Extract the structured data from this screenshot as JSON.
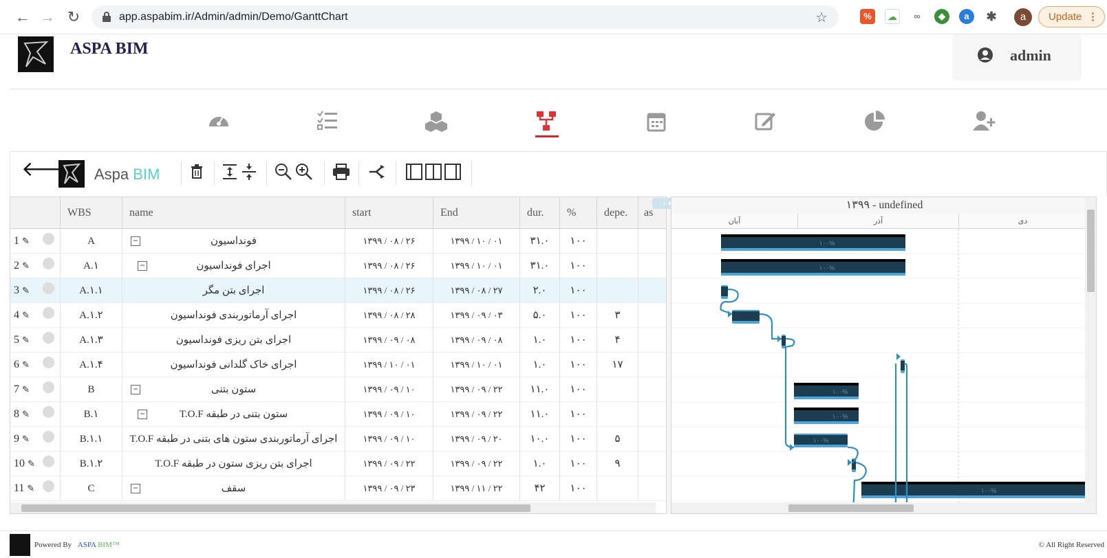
{
  "browser": {
    "url": "app.aspabim.ir/Admin/admin/Demo/GanttChart",
    "update_label": "Update",
    "profile_initial": "a",
    "extensions": [
      "grammar-ext-icon",
      "cloud-ext-icon",
      "link-ext-icon",
      "globe-ext-icon",
      "a-ext-icon",
      "puzzle-icon"
    ]
  },
  "header": {
    "brand": "ASPA BIM",
    "user": "admin"
  },
  "toolbar": {
    "brand_aspa": "Aspa",
    "brand_bim": "BIM"
  },
  "grid": {
    "columns": [
      "WBS",
      "name",
      "start",
      "End",
      "dur.",
      "%",
      "depe.",
      "as"
    ],
    "rows": [
      {
        "num": "1",
        "wbs": "A",
        "name": "فونداسیون",
        "start": "۱۳۹۹ / ۰۸ / ۲۶",
        "end": "۱۳۹۹ / ۱۰ / ۰۱",
        "dur": "۳۱.۰",
        "pct": "۱۰۰",
        "dep": "",
        "collapse": true,
        "level": 0
      },
      {
        "num": "2",
        "wbs": "A.۱",
        "name": "اجرای فونداسیون",
        "start": "۱۳۹۹ / ۰۸ / ۲۶",
        "end": "۱۳۹۹ / ۱۰ / ۰۱",
        "dur": "۳۱.۰",
        "pct": "۱۰۰",
        "dep": "",
        "collapse": true,
        "level": 1
      },
      {
        "num": "3",
        "wbs": "A.۱.۱",
        "name": "اجرای بتن مگر",
        "start": "۱۳۹۹ / ۰۸ / ۲۶",
        "end": "۱۳۹۹ / ۰۸ / ۲۷",
        "dur": "۲.۰",
        "pct": "۱۰۰",
        "dep": "",
        "collapse": false,
        "level": 2
      },
      {
        "num": "4",
        "wbs": "A.۱.۲",
        "name": "اجرای آرماتوربندی فونداسیون",
        "start": "۱۳۹۹ / ۰۸ / ۲۸",
        "end": "۱۳۹۹ / ۰۹ / ۰۳",
        "dur": "۵.۰",
        "pct": "۱۰۰",
        "dep": "۳",
        "collapse": false,
        "level": 2
      },
      {
        "num": "5",
        "wbs": "A.۱.۳",
        "name": "اجرای بتن ریزی فونداسیون",
        "start": "۱۳۹۹ / ۰۹ / ۰۸",
        "end": "۱۳۹۹ / ۰۹ / ۰۸",
        "dur": "۱.۰",
        "pct": "۱۰۰",
        "dep": "۴",
        "collapse": false,
        "level": 2
      },
      {
        "num": "6",
        "wbs": "A.۱.۴",
        "name": "اجرای خاک گلدانی فونداسیون",
        "start": "۱۳۹۹ / ۱۰ / ۰۱",
        "end": "۱۳۹۹ / ۱۰ / ۰۱",
        "dur": "۱.۰",
        "pct": "۱۰۰",
        "dep": "۱۷",
        "collapse": false,
        "level": 2
      },
      {
        "num": "7",
        "wbs": "B",
        "name": "ستون بتنی",
        "start": "۱۳۹۹ / ۰۹ / ۱۰",
        "end": "۱۳۹۹ / ۰۹ / ۲۲",
        "dur": "۱۱.۰",
        "pct": "۱۰۰",
        "dep": "",
        "collapse": true,
        "level": 0
      },
      {
        "num": "8",
        "wbs": "B.۱",
        "name": "ستون بتنی در طبقه T.O.F",
        "start": "۱۳۹۹ / ۰۹ / ۱۰",
        "end": "۱۳۹۹ / ۰۹ / ۲۲",
        "dur": "۱۱.۰",
        "pct": "۱۰۰",
        "dep": "",
        "collapse": true,
        "level": 1
      },
      {
        "num": "9",
        "wbs": "B.۱.۱",
        "name": "اجرای آرماتوربندی ستون های بتنی در طبقه T.O.F",
        "start": "۱۳۹۹ / ۰۹ / ۱۰",
        "end": "۱۳۹۹ / ۰۹ / ۲۰",
        "dur": "۱۰.۰",
        "pct": "۱۰۰",
        "dep": "۵",
        "collapse": false,
        "level": 2
      },
      {
        "num": "10",
        "wbs": "B.۱.۲",
        "name": "اجرای بتن ریزی ستون در طبقه T.O.F",
        "start": "۱۳۹۹ / ۰۹ / ۲۲",
        "end": "۱۳۹۹ / ۰۹ / ۲۲",
        "dur": "۱.۰",
        "pct": "۱۰۰",
        "dep": "۹",
        "collapse": false,
        "level": 2
      },
      {
        "num": "11",
        "wbs": "C",
        "name": "سقف",
        "start": "۱۳۹۹ / ۰۹ / ۲۳",
        "end": "۱۳۹۹ / ۱۱ / ۲۲",
        "dur": "۴۲",
        "pct": "۱۰۰",
        "dep": "",
        "collapse": true,
        "level": 0
      }
    ]
  },
  "gantt": {
    "title": "۱۳۹۹ - undefined",
    "months": [
      "آبان",
      "آذر",
      "دی"
    ],
    "bar_label": "۱۰۰%"
  },
  "footer": {
    "powered_by": "Powered By",
    "aspa": "ASPA",
    "bim": "BIM™",
    "rights": "© All Right Reserved"
  },
  "colors": {
    "bar_dark": "#1c3e50",
    "bar_light": "#4aa3d9",
    "link": "#2f8fc2",
    "active_nav": "#cc2a2a"
  }
}
